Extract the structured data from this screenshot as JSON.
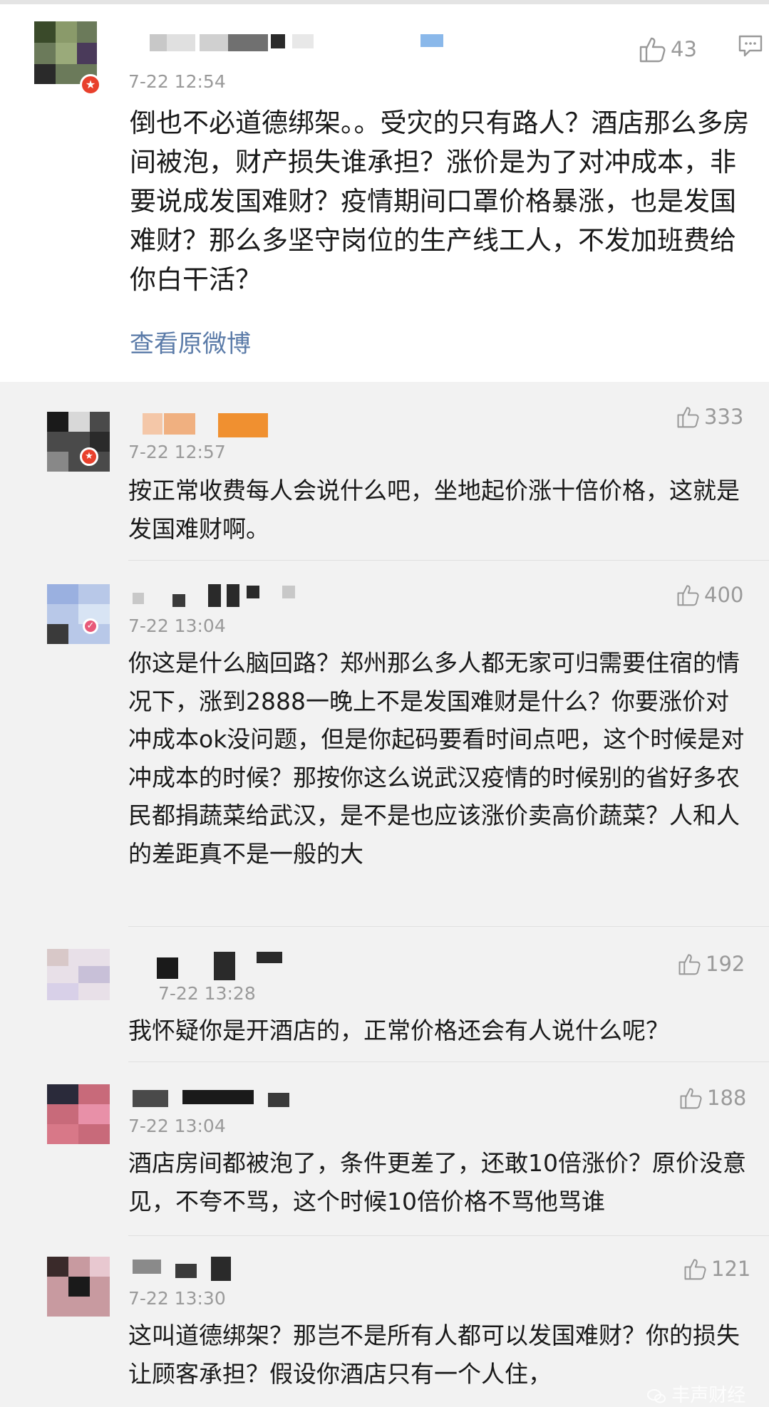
{
  "main_post": {
    "time": "7-22 12:54",
    "text": "倒也不必道德绑架。。受灾的只有路人？酒店那么多房间被泡，财产损失谁承担？涨价是为了对冲成本，非要说成发国难财？疫情期间口罩价格暴涨，也是发国难财？那么多坚守岗位的生产线工人，不发加班费给你白干活？",
    "likes": "43",
    "view_original": "查看原微博"
  },
  "replies": [
    {
      "time": "7-22 12:57",
      "likes": "333",
      "text": "按正常收费每人会说什么吧，坐地起价涨十倍价格，这就是发国难财啊。"
    },
    {
      "time": "7-22 13:04",
      "likes": "400",
      "text": "你这是什么脑回路？郑州那么多人都无家可归需要住宿的情况下，涨到2888一晚上不是发国难财是什么？你要涨价对冲成本ok没问题，但是你起码要看时间点吧，这个时候是对冲成本的时候？那按你这么说武汉疫情的时候别的省好多农民都捐蔬菜给武汉，是不是也应该涨价卖高价蔬菜？人和人的差距真不是一般的大"
    },
    {
      "time": "7-22 13:28",
      "likes": "192",
      "text": "我怀疑你是开酒店的，正常价格还会有人说什么呢？"
    },
    {
      "time": "7-22 13:04",
      "likes": "188",
      "text": "酒店房间都被泡了，条件更差了，还敢10倍涨价？原价没意见，不夸不骂，这个时候10倍价格不骂他骂谁"
    },
    {
      "time": "7-22 13:30",
      "likes": "121",
      "text": "这叫道德绑架？那岂不是所有人都可以发国难财？你的损失让顾客承担？假设你酒店只有一个人住，"
    }
  ],
  "watermark": "丰声财经",
  "colors": {
    "link": "#5b7ba8",
    "meta": "#9a9a9a",
    "badge": "#e8402c"
  }
}
